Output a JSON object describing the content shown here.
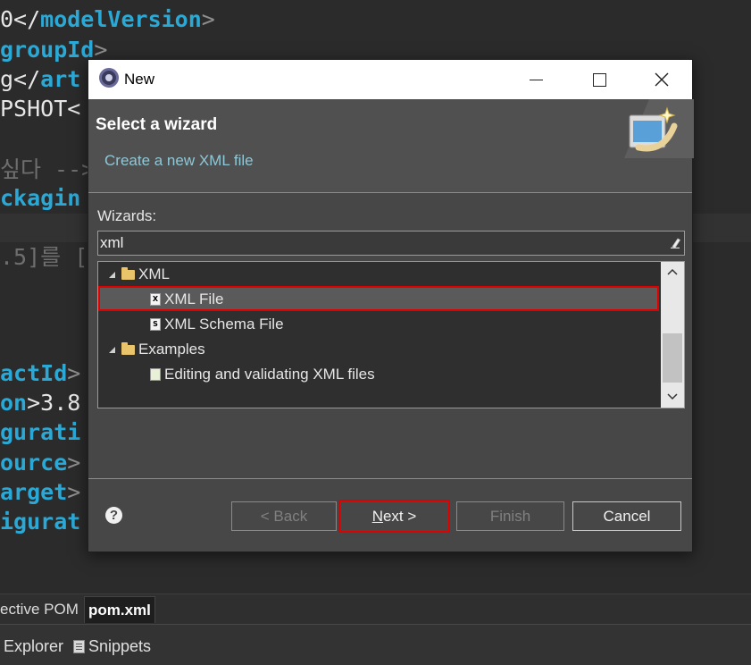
{
  "editor": {
    "lines": [
      {
        "a": "0</",
        "b": "modelVersion",
        "c": ">"
      },
      {
        "a": "",
        "b": "groupId",
        "c": ">"
      },
      {
        "a": "g</",
        "b": "art",
        "c": ""
      },
      {
        "a": "PSHOT<",
        "b": "",
        "c": ""
      },
      {
        "a": "싶다 -->",
        "b": "",
        "c": ""
      },
      {
        "a": "",
        "b": "ckagin",
        "c": ""
      },
      {
        "a": ".5]를 [",
        "b": "",
        "c": ""
      },
      {
        "a": "",
        "b": "actId",
        "c": ">"
      },
      {
        "a": "",
        "b": "on",
        "c": ">3.8"
      },
      {
        "a": "",
        "b": "gurati",
        "c": ""
      },
      {
        "a": "",
        "b": "ource",
        "c": ">"
      },
      {
        "a": "",
        "b": "arget",
        "c": ">"
      },
      {
        "a": "",
        "b": "igurat",
        "c": ""
      }
    ]
  },
  "editor_tabs": [
    {
      "label": "ective POM"
    },
    {
      "label": "pom.xml"
    }
  ],
  "views_bar": {
    "explorer": "Explorer",
    "snippets": "Snippets"
  },
  "dialog": {
    "title": "New",
    "header_title": "Select a wizard",
    "header_desc": "Create a new XML file",
    "wizards_label": "Wizards:",
    "filter_value": "xml",
    "tree": {
      "xml_folder": "XML",
      "xml_file": "XML File",
      "xml_schema_file": "XML Schema File",
      "examples_folder": "Examples",
      "example_item": "Editing and validating XML files"
    },
    "buttons": {
      "back": "< Back",
      "next_mnemonic": "N",
      "next_rest": "ext >",
      "finish": "Finish",
      "cancel": "Cancel"
    },
    "help": "?"
  },
  "colors": {
    "highlight_border": "#e00000",
    "tag_blue": "#2aa9d6",
    "dialog_bg": "#474747"
  }
}
